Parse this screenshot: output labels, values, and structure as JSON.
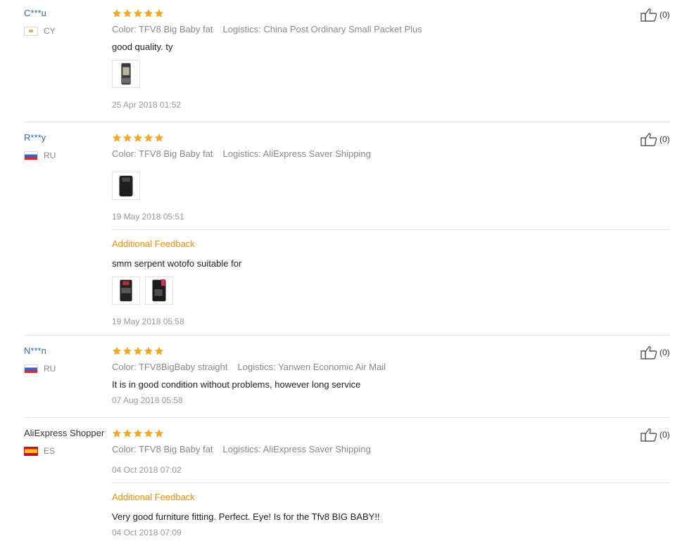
{
  "reviews": [
    {
      "user": "C***u",
      "country": "CY",
      "rating": 5,
      "color": "Color: TFV8 Big Baby fat",
      "logistics": "Logistics: China Post Ordinary Small Packet Plus",
      "text": "good quality. ty",
      "date": "25 Apr 2018 01:52",
      "likes": "(0)"
    },
    {
      "user": "R***y",
      "country": "RU",
      "rating": 5,
      "color": "Color: TFV8 Big Baby fat",
      "logistics": "Logistics: AliExpress Saver Shipping",
      "text": "",
      "date": "19 May 2018 05:51",
      "likes": "(0)",
      "additional": {
        "label": "Additional Feedback",
        "text": "smm serpent wotofo suitable for",
        "date": "19 May 2018 05:58"
      }
    },
    {
      "user": "N***n",
      "country": "RU",
      "rating": 5,
      "color": "Color: TFV8BigBaby straight",
      "logistics": "Logistics: Yanwen Economic Air Mail",
      "text": "It is in good condition without problems, however long service",
      "date": "07 Aug 2018 05:58",
      "likes": "(0)"
    },
    {
      "user": "AliExpress Shopper",
      "country": "ES",
      "rating": 5,
      "color": "Color: TFV8 Big Baby fat",
      "logistics": "Logistics: AliExpress Saver Shipping",
      "text": "",
      "date": "04 Oct 2018 07:02",
      "likes": "(0)",
      "additional": {
        "label": "Additional Feedback",
        "text": "Very good furniture fitting. Perfect. Eye! Is for the Tfv8 BIG BABY!!",
        "date": "04 Oct 2018 07:09"
      }
    }
  ],
  "colors": {
    "username": "#2e6bb3",
    "star": "#f5a623",
    "additional_feedback": "#e88f14",
    "muted": "#888888"
  },
  "icons": [
    "star-icon",
    "thumbs-up-icon",
    "flag-icon"
  ]
}
